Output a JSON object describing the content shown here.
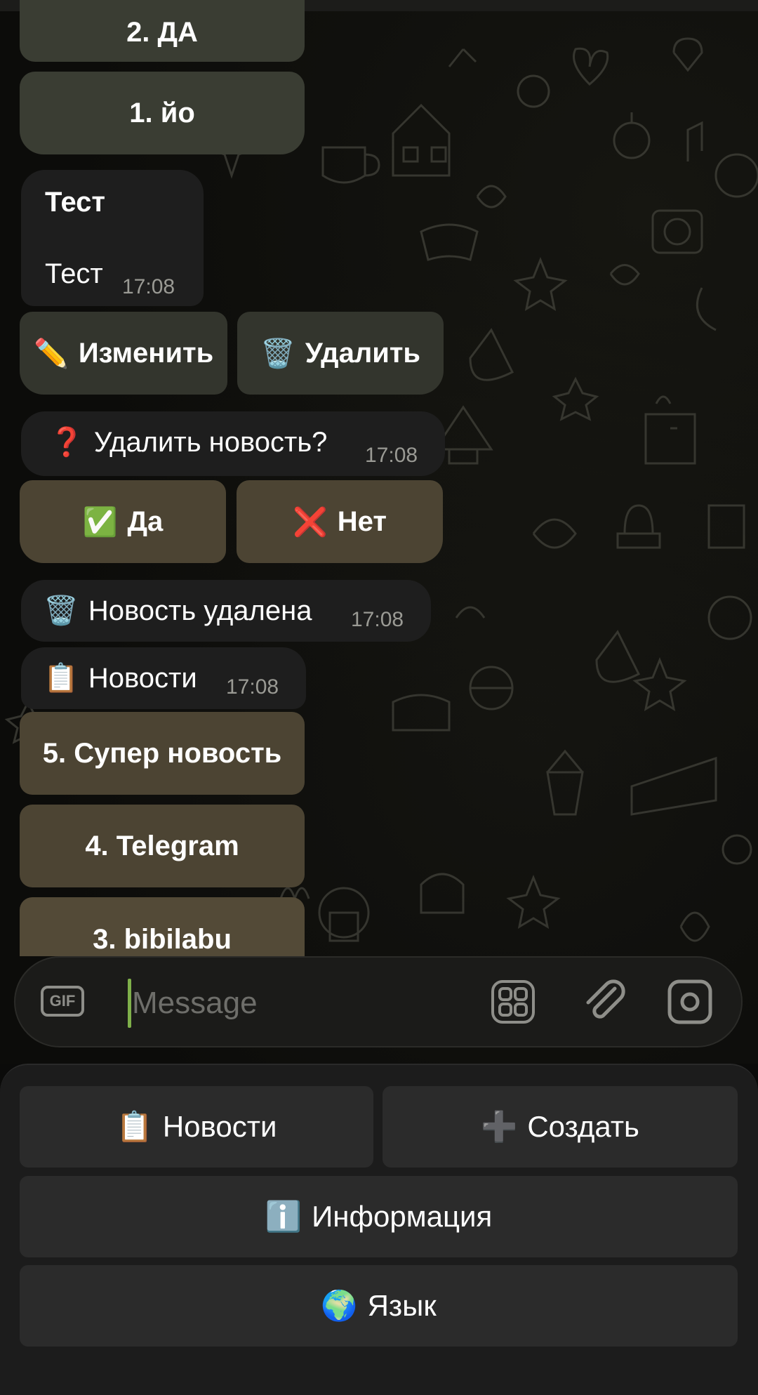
{
  "chat": {
    "buttons_top": [
      {
        "label": "2. ДА"
      },
      {
        "label": "1. йо"
      }
    ],
    "message_test": {
      "title": "Тест",
      "body": "Тест",
      "time": "17:08"
    },
    "action_buttons": {
      "edit_icon": "✏️",
      "edit_label": "Изменить",
      "delete_icon": "🗑️",
      "delete_label": "Удалить"
    },
    "confirm_message": {
      "icon": "❓",
      "text": "Удалить новость?",
      "time": "17:08"
    },
    "confirm_buttons": {
      "yes_icon": "✅",
      "yes_label": "Да",
      "no_icon": "❌",
      "no_label": "Нет"
    },
    "deleted_message": {
      "icon": "🗑️",
      "text": "Новость удалена",
      "time": "17:08"
    },
    "news_message": {
      "icon": "📋",
      "text": "Новости",
      "time": "17:08"
    },
    "news_list": [
      {
        "label": "5. Супер новость"
      },
      {
        "label": "4. Telegram"
      },
      {
        "label": "3. bibilabu"
      }
    ]
  },
  "composer": {
    "placeholder": "Message",
    "gif_label": "GIF"
  },
  "keyboard": {
    "news": {
      "icon": "📋",
      "label": "Новости"
    },
    "create": {
      "icon": "➕",
      "label": "Создать"
    },
    "info": {
      "icon": "ℹ️",
      "label": "Информация"
    },
    "language": {
      "icon": "🌍",
      "label": "Язык"
    }
  },
  "colors": {
    "olive_button": "#3a3d33",
    "brown_button": "#4c4433",
    "bubble": "#1e1e1e",
    "keyboard_bg": "#1c1c1c",
    "caret": "#7fb04a"
  }
}
